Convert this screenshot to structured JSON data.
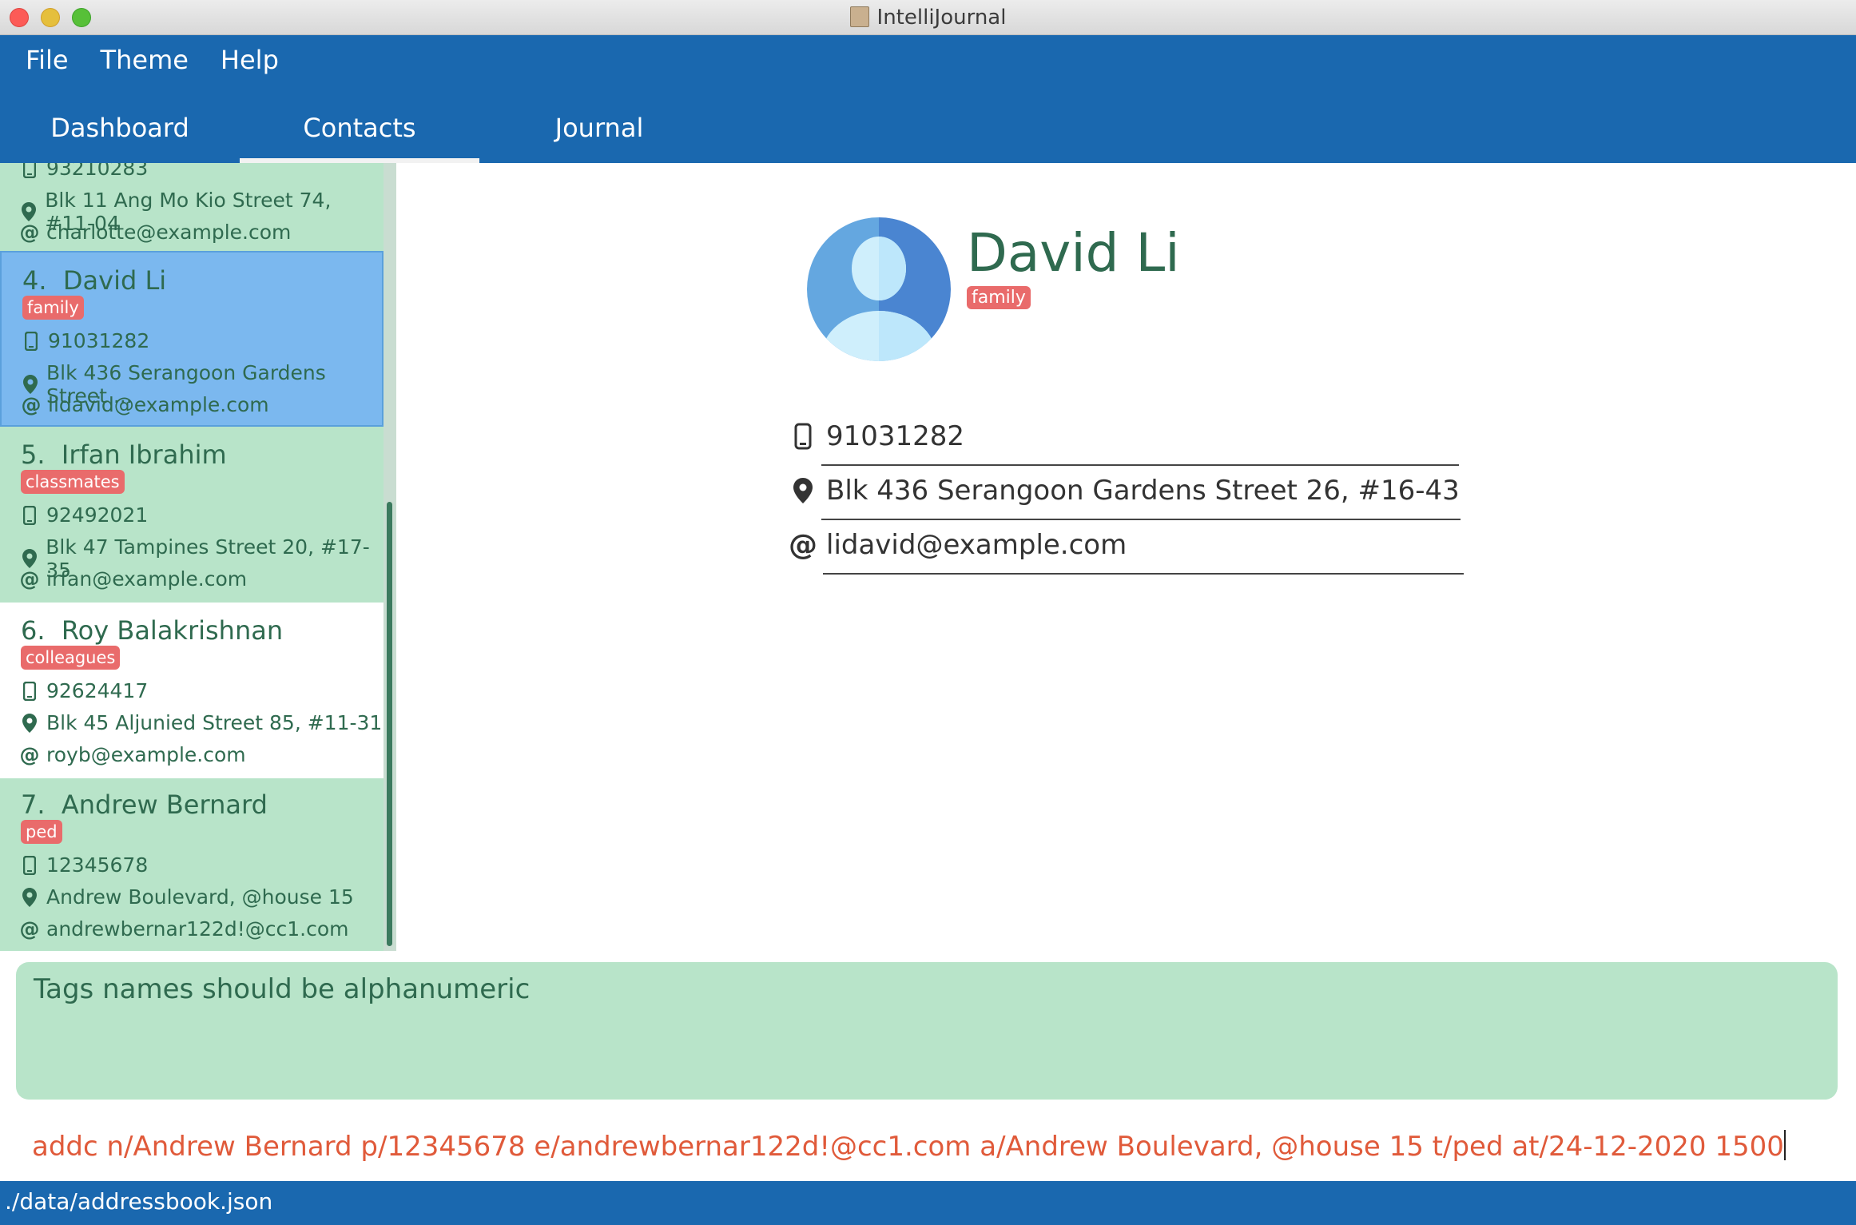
{
  "window": {
    "title": "IntelliJournal"
  },
  "menu": [
    "File",
    "Theme",
    "Help"
  ],
  "tabs": [
    {
      "label": "Dashboard",
      "active": false
    },
    {
      "label": "Contacts",
      "active": true
    },
    {
      "label": "Journal",
      "active": false
    }
  ],
  "contacts": [
    {
      "index": "",
      "name": "",
      "tag": "",
      "phone": "93210283",
      "address": "Blk 11 Ang Mo Kio Street 74, #11-04",
      "email": "charlotte@example.com",
      "state": "normal"
    },
    {
      "index": "4.",
      "name": "David Li",
      "tag": "family",
      "phone": "91031282",
      "address": "Blk 436 Serangoon Gardens Street ...",
      "email": "lidavid@example.com",
      "state": "selected"
    },
    {
      "index": "5.",
      "name": "Irfan Ibrahim",
      "tag": "classmates",
      "phone": "92492021",
      "address": "Blk 47 Tampines Street 20, #17-35",
      "email": "irfan@example.com",
      "state": "normal"
    },
    {
      "index": "6.",
      "name": "Roy Balakrishnan",
      "tag": "colleagues",
      "phone": "92624417",
      "address": "Blk 45 Aljunied Street 85, #11-31",
      "email": "royb@example.com",
      "state": "plain"
    },
    {
      "index": "7.",
      "name": "Andrew Bernard",
      "tag": "ped",
      "phone": "12345678",
      "address": "Andrew Boulevard, @house 15",
      "email": "andrewbernar122d!@cc1.com",
      "state": "normal"
    }
  ],
  "detail": {
    "name": "David Li",
    "tag": "family",
    "phone": "91031282",
    "address": "Blk 436 Serangoon Gardens Street 26, #16-43",
    "email": "lidavid@example.com"
  },
  "result_message": "Tags names should be alphanumeric",
  "command_text": "addc n/Andrew Bernard p/12345678 e/andrewbernar122d!@cc1.com a/Andrew Boulevard, @house 15 t/ped at/24-12-2020 1500",
  "status_path": "./data/addressbook.json",
  "colors": {
    "header": "#1a68af",
    "list_bg": "#b8e4c9",
    "selected": "#7bb8ef",
    "tag": "#e96b6b",
    "error_text": "#e05a3a"
  },
  "icons": {
    "phone": "phone-icon",
    "address": "location-pin-icon",
    "email": "at-sign-icon"
  }
}
